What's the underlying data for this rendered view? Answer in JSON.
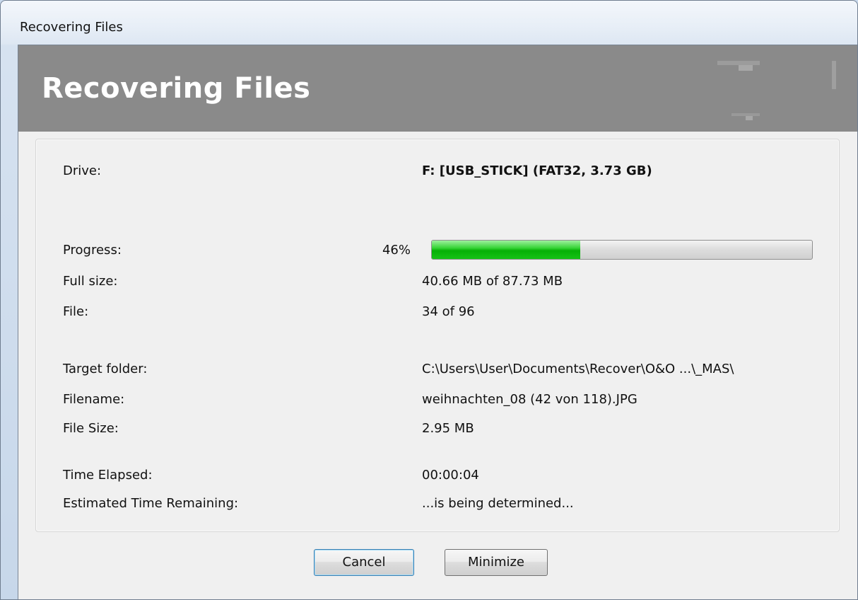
{
  "window": {
    "title": "Recovering Files"
  },
  "banner": {
    "title": "Recovering Files"
  },
  "details": {
    "drive_label": "Drive:",
    "drive_value": "F: [USB_STICK] (FAT32, 3.73 GB)",
    "progress_label": "Progress:",
    "progress_percent_text": "46%",
    "progress_value": 0.39,
    "full_size_label": "Full size:",
    "full_size_value": "40.66 MB of 87.73 MB",
    "file_label": "File:",
    "file_value": "34 of 96",
    "target_folder_label": "Target folder:",
    "target_folder_value": "C:\\Users\\User\\Documents\\Recover\\O&O ...\\_MAS\\",
    "filename_label": "Filename:",
    "filename_value": "weihnachten_08 (42 von 118).JPG",
    "file_size_label": "File Size:",
    "file_size_value": "2.95 MB",
    "time_elapsed_label": "Time Elapsed:",
    "time_elapsed_value": "00:00:04",
    "time_remaining_label": "Estimated Time Remaining:",
    "time_remaining_value": "...is being determined..."
  },
  "buttons": {
    "cancel_label": "Cancel",
    "minimize_label": "Minimize"
  },
  "colors": {
    "banner": "#8a8a8a",
    "progress_fill": "#16c216"
  }
}
